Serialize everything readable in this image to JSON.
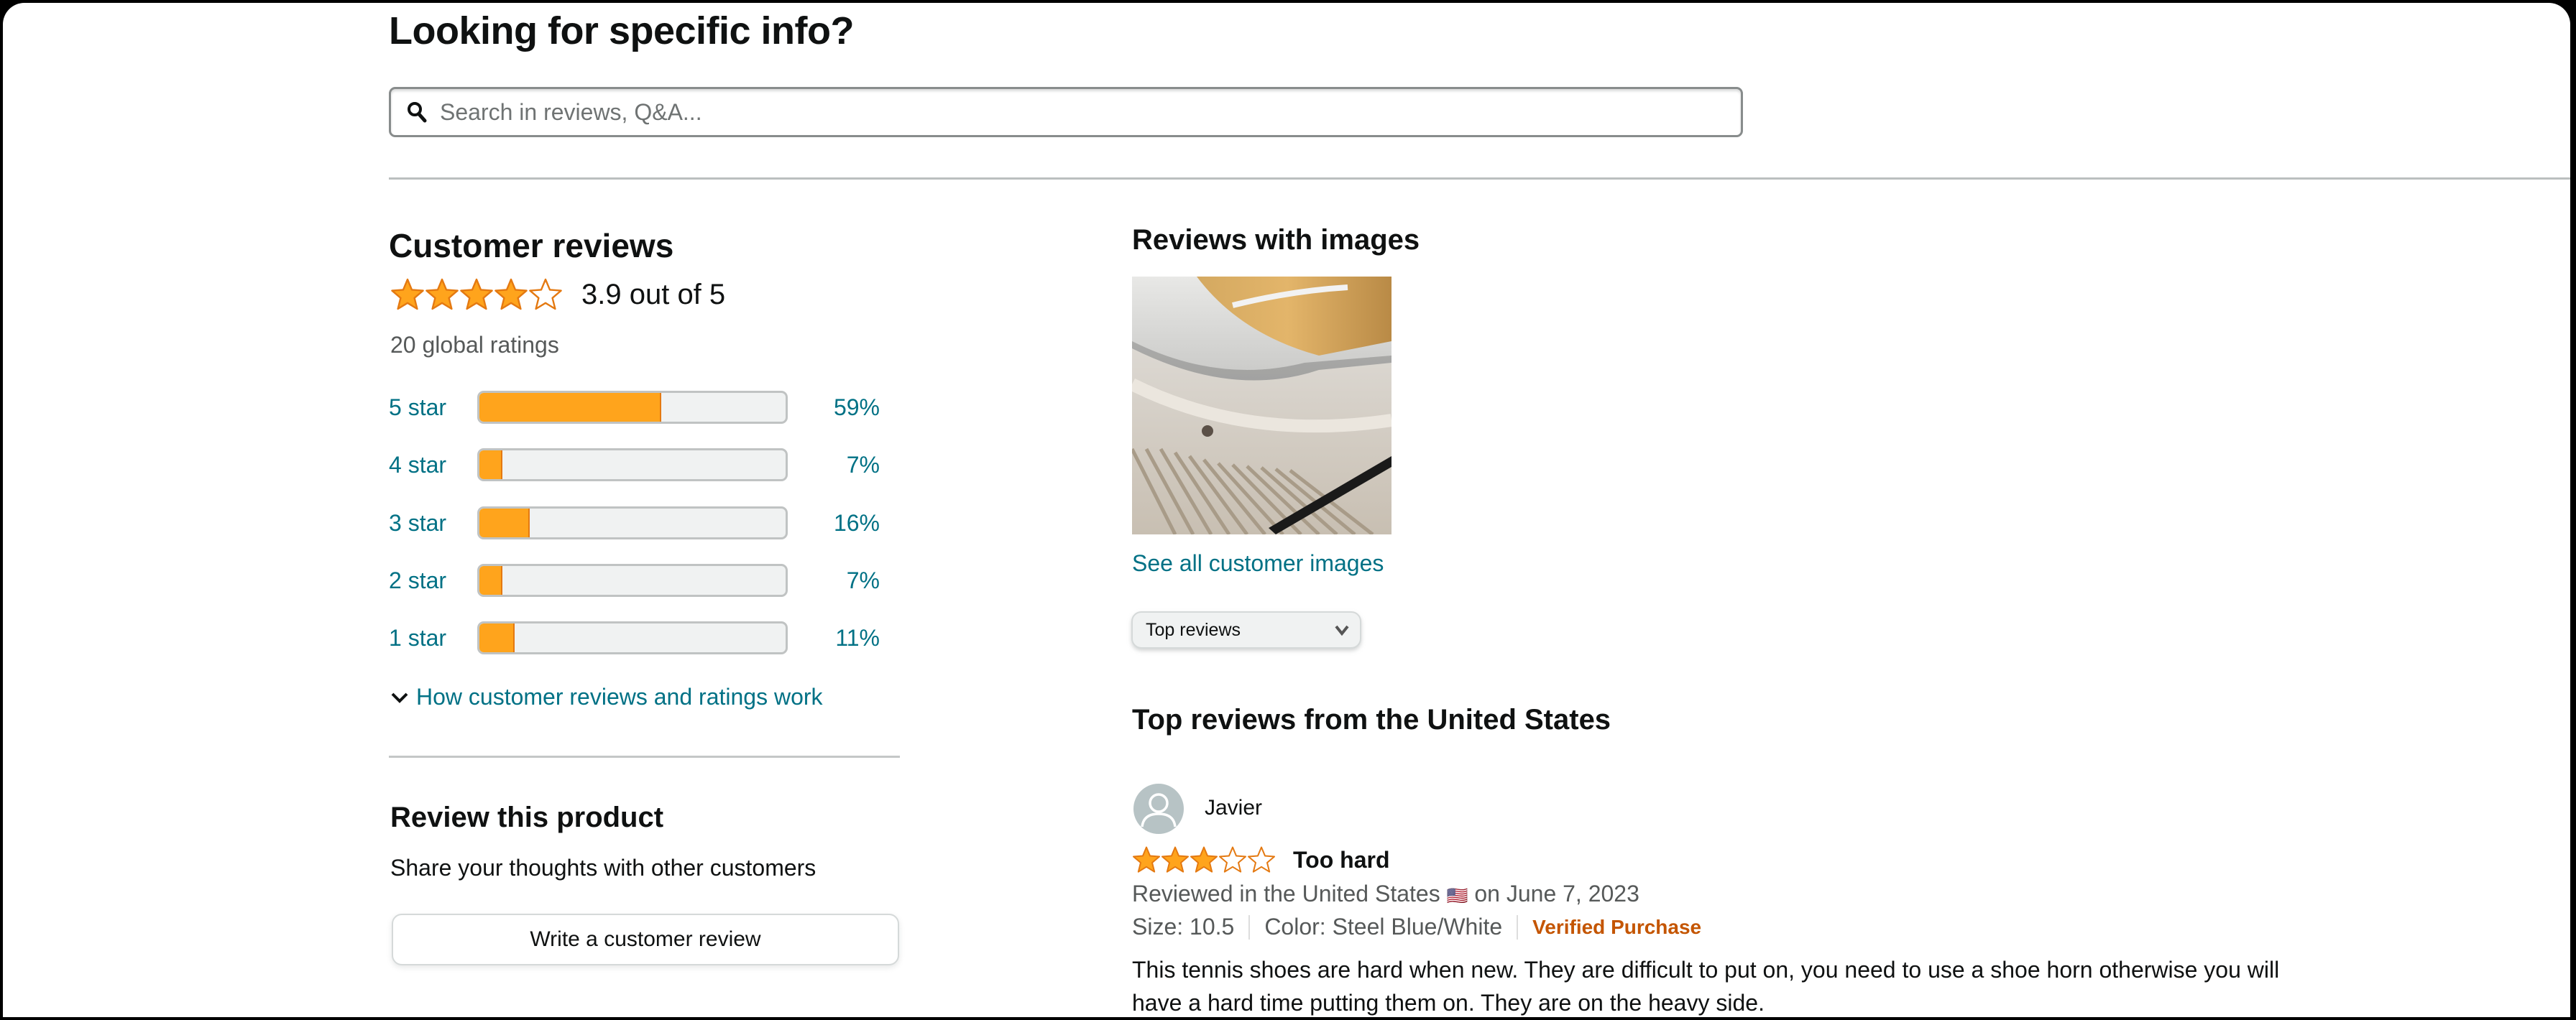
{
  "search_section": {
    "title": "Looking for specific info?",
    "search_placeholder": "Search in reviews, Q&A...",
    "search_value": ""
  },
  "customer_reviews": {
    "title": "Customer reviews",
    "average_rating": 3.9,
    "rating_text": "3.9 out of 5",
    "global_ratings": "20 global ratings",
    "histogram": [
      {
        "label": "5 star",
        "percent_text": "59%",
        "percent": 59
      },
      {
        "label": "4 star",
        "percent_text": "7%",
        "percent": 7
      },
      {
        "label": "3 star",
        "percent_text": "16%",
        "percent": 16
      },
      {
        "label": "2 star",
        "percent_text": "7%",
        "percent": 7
      },
      {
        "label": "1 star",
        "percent_text": "11%",
        "percent": 11
      }
    ],
    "how_it_works_link": "How customer reviews and ratings work"
  },
  "review_product": {
    "title": "Review this product",
    "subtitle": "Share your thoughts with other customers",
    "button_label": "Write a customer review"
  },
  "reviews_with_images": {
    "title": "Reviews with images",
    "see_all_link": "See all customer images",
    "image_alt": "Close-up of a white tennis shoe"
  },
  "sort": {
    "selected": "Top reviews"
  },
  "top_reviews": {
    "title": "Top reviews from the United States",
    "reviews": [
      {
        "author": "Javier",
        "rating": 3,
        "headline": "Too hard",
        "reviewed_in": "Reviewed in the United States",
        "flag": "🇺🇸",
        "date": "on June 7, 2023",
        "size": "Size: 10.5",
        "color": "Color: Steel Blue/White",
        "verified": "Verified Purchase",
        "body": "This tennis shoes are hard when new. They are difficult to put on, you need to use a shoe horn otherwise you will have a hard time putting them on. They are on the heavy side."
      }
    ]
  },
  "colors": {
    "star": "#FFA41C",
    "star_stroke": "#E47911",
    "link": "#007185",
    "verified": "#C45500"
  }
}
